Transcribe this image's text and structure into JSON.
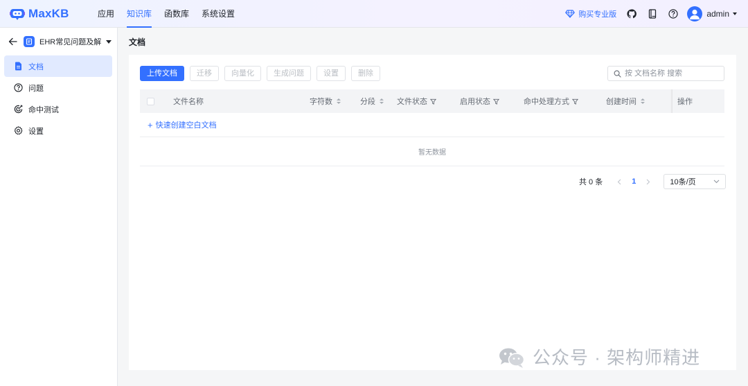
{
  "app": {
    "logo_text": "MaxKB"
  },
  "nav": {
    "items": [
      "应用",
      "知识库",
      "函数库",
      "系统设置"
    ]
  },
  "topbar": {
    "upgrade_label": "购买专业版",
    "user_name": "admin"
  },
  "sidebar": {
    "kb_name": "EHR常见问题及解...",
    "items": [
      "文档",
      "问题",
      "命中测试",
      "设置"
    ]
  },
  "page": {
    "title": "文档"
  },
  "toolbar": {
    "upload_label": "上传文档",
    "migrate_label": "迁移",
    "vectorize_label": "向量化",
    "gen_questions_label": "生成问题",
    "settings_label": "设置",
    "delete_label": "删除"
  },
  "search": {
    "placeholder": "按 文档名称 搜索"
  },
  "table": {
    "columns": [
      "文件名称",
      "字符数",
      "分段",
      "文件状态",
      "启用状态",
      "命中处理方式",
      "创建时间",
      "操作"
    ],
    "quick_create_label": "快速创建空白文档",
    "empty_text": "暂无数据"
  },
  "pagination": {
    "total_text": "共 0 条",
    "current_page": "1",
    "page_size": "10条/页"
  },
  "watermark": {
    "text": "公众号 · 架构师精进"
  },
  "colors": {
    "accent": "#3370ff",
    "active_bg": "#e1eaff",
    "header_bg": "#f3f4f6"
  }
}
